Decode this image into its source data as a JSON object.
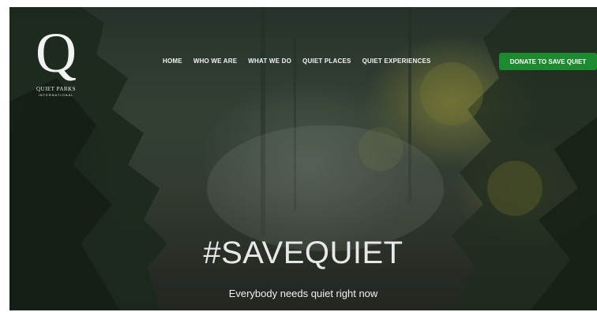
{
  "logo": {
    "letter": "Q",
    "name": "QUIET PARKS",
    "sub": "INTERNATIONAL"
  },
  "nav": {
    "items": [
      "HOME",
      "WHO WE ARE",
      "WHAT WE DO",
      "QUIET PLACES",
      "QUIET EXPERIENCES"
    ],
    "donate_label": "DONATE TO SAVE QUIET"
  },
  "hero": {
    "headline": "#SAVEQUIET",
    "tagline": "Everybody needs quiet right now"
  },
  "colors": {
    "donate_green": "#1e8a2f",
    "nav_text": "#f4f4f4",
    "forest_dark": "#2c3a30"
  }
}
